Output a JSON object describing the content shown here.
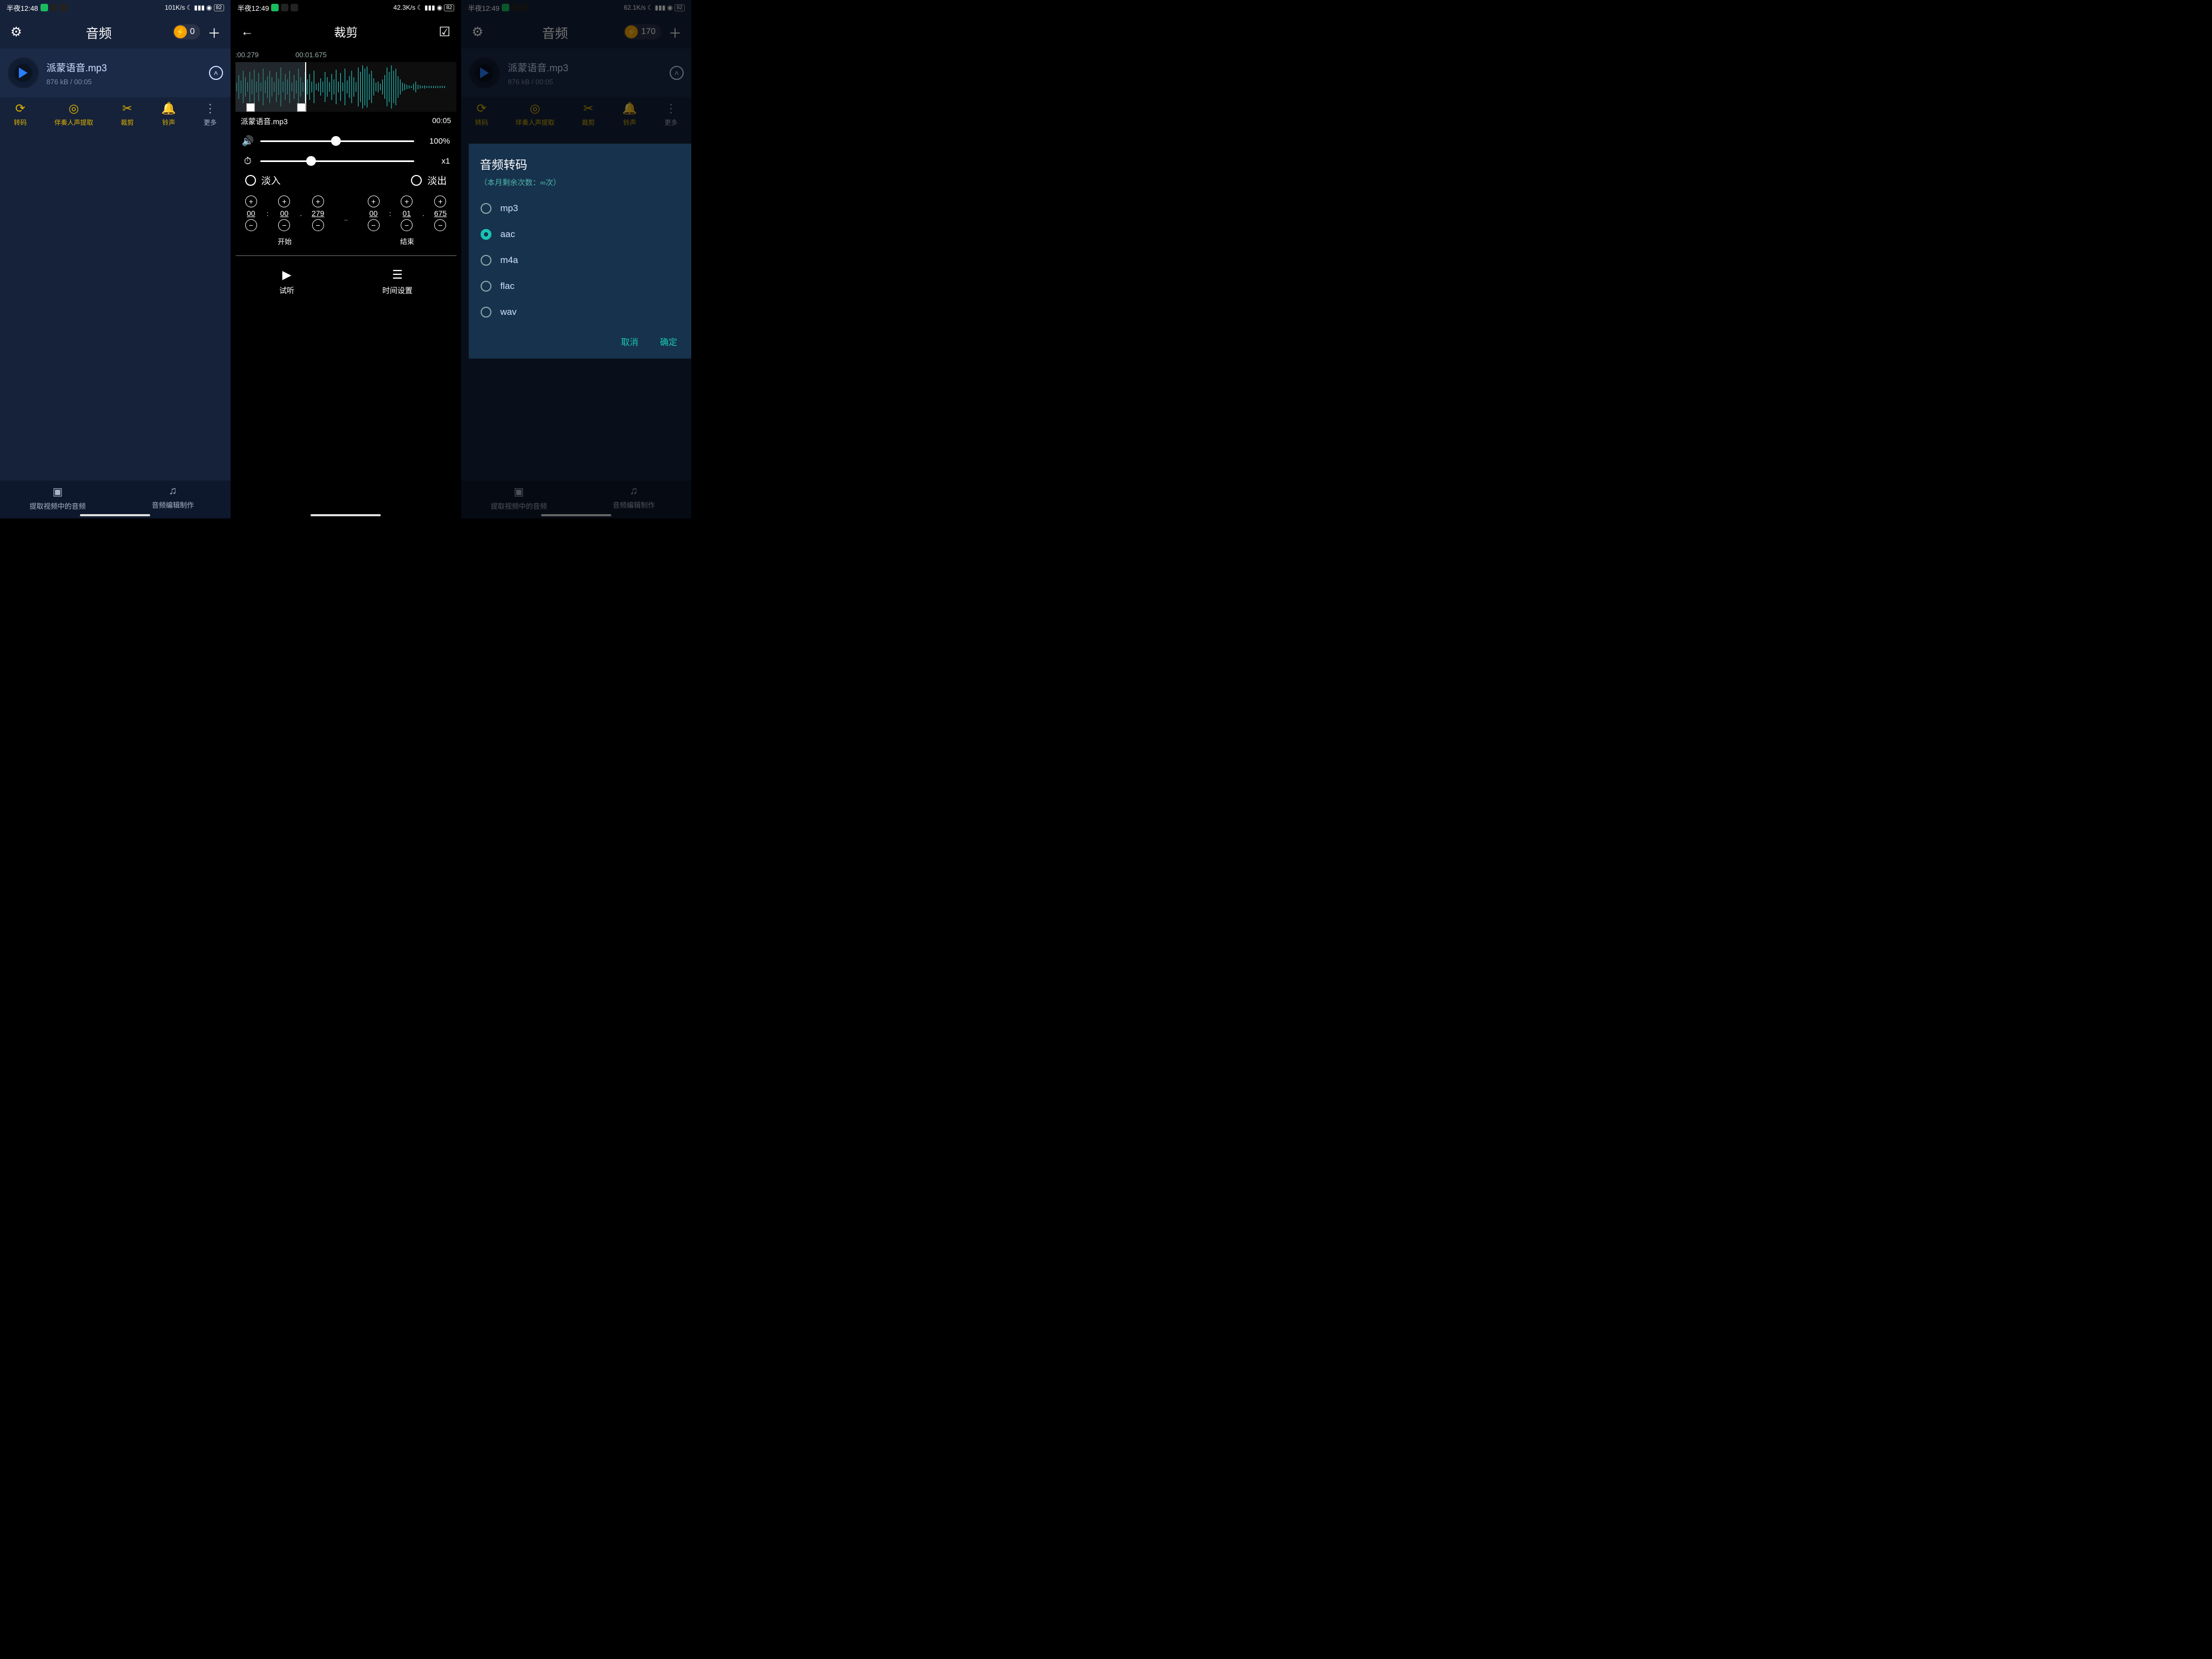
{
  "screens": {
    "a": {
      "status": {
        "time": "半夜12:48",
        "net": "101K/s",
        "bat": "82"
      },
      "title": "音频",
      "coin_value": "0",
      "audio": {
        "name": "派蒙语音.mp3",
        "meta": "876 kB / 00:05"
      },
      "tools": [
        {
          "label": "转码"
        },
        {
          "label": "伴奏人声提取"
        },
        {
          "label": "裁剪"
        },
        {
          "label": "铃声"
        },
        {
          "label": "更多"
        }
      ],
      "bottom": [
        {
          "label": "提取视频中的音频"
        },
        {
          "label": "音频编辑制作"
        }
      ]
    },
    "b": {
      "status": {
        "time": "半夜12:49",
        "net": "42.3K/s",
        "bat": "82"
      },
      "title": "裁剪",
      "timeline": {
        "t1": ":00.279",
        "t2": "00:01.675"
      },
      "file": "派蒙语音.mp3",
      "duration": "00:05",
      "volume": "100%",
      "speed": "x1",
      "fade_in": "淡入",
      "fade_out": "淡出",
      "start_label": "开始",
      "end_label": "结束",
      "start": {
        "mm": "00",
        "ss": "00",
        "ms": "279"
      },
      "end": {
        "mm": "00",
        "ss": "01",
        "ms": "675"
      },
      "actions": {
        "preview": "试听",
        "time_settings": "时间设置"
      }
    },
    "c": {
      "status": {
        "time": "半夜12:49",
        "net": "62.1K/s",
        "bat": "82"
      },
      "title": "音频",
      "coin_value": "170",
      "audio": {
        "name": "派蒙语音.mp3",
        "meta": "876 kB / 00:05"
      },
      "dialog": {
        "title": "音频转码",
        "sub": "（本月剩余次数：∞次）",
        "options": [
          "mp3",
          "aac",
          "m4a",
          "flac",
          "wav"
        ],
        "selected": "aac",
        "cancel": "取消",
        "ok": "确定"
      },
      "bottom": [
        {
          "label": "提取视频中的音频"
        },
        {
          "label": "音频编辑制作"
        }
      ]
    }
  }
}
